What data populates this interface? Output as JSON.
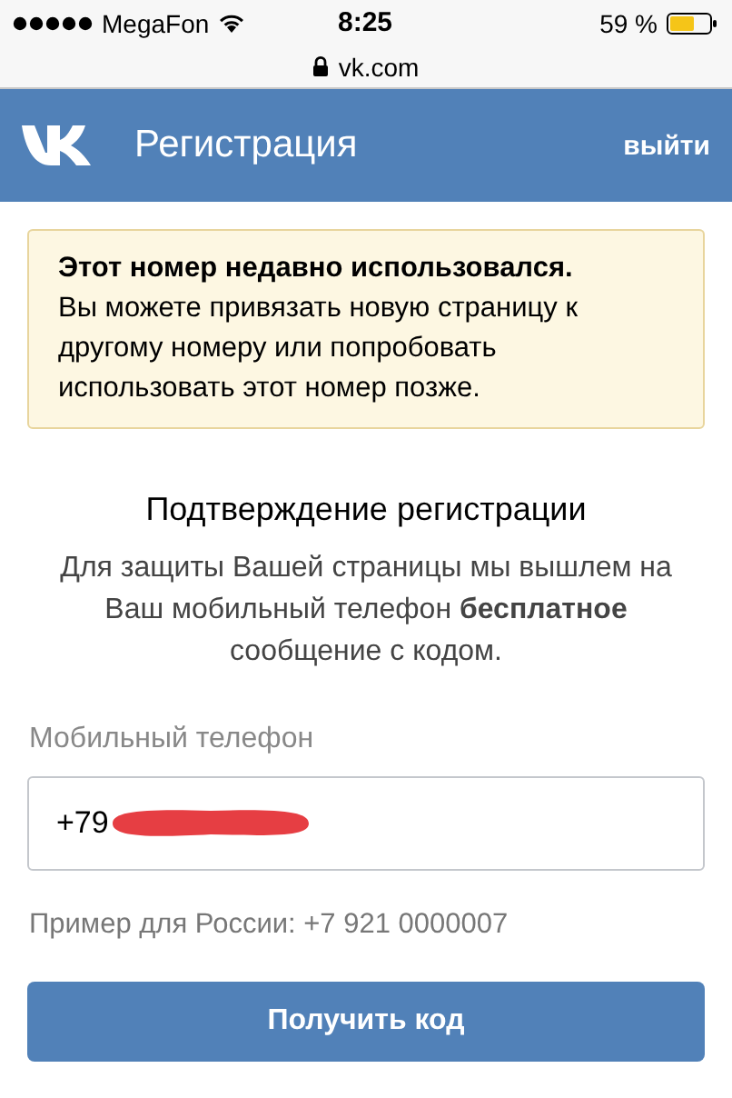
{
  "status_bar": {
    "carrier": "MegaFon",
    "time": "8:25",
    "battery": "59 %"
  },
  "address_bar": {
    "url": "vk.com"
  },
  "header": {
    "title": "Регистрация",
    "action": "выйти"
  },
  "warning": {
    "title": "Этот номер недавно использовался.",
    "text": "Вы можете привязать новую страницу к другому номеру или попробовать использовать этот номер позже."
  },
  "confirmation": {
    "title": "Подтверждение регистрации",
    "text": "Для защиты Вашей страницы мы вышлем на Ваш мобильный телефон **бесплатное** сообщение с кодом."
  },
  "phone_field": {
    "label": "Мобильный телефон",
    "value": "+79",
    "redacted": true
  },
  "example": "Пример для России: +7 921 0000007",
  "submit_button": "Получить код"
}
